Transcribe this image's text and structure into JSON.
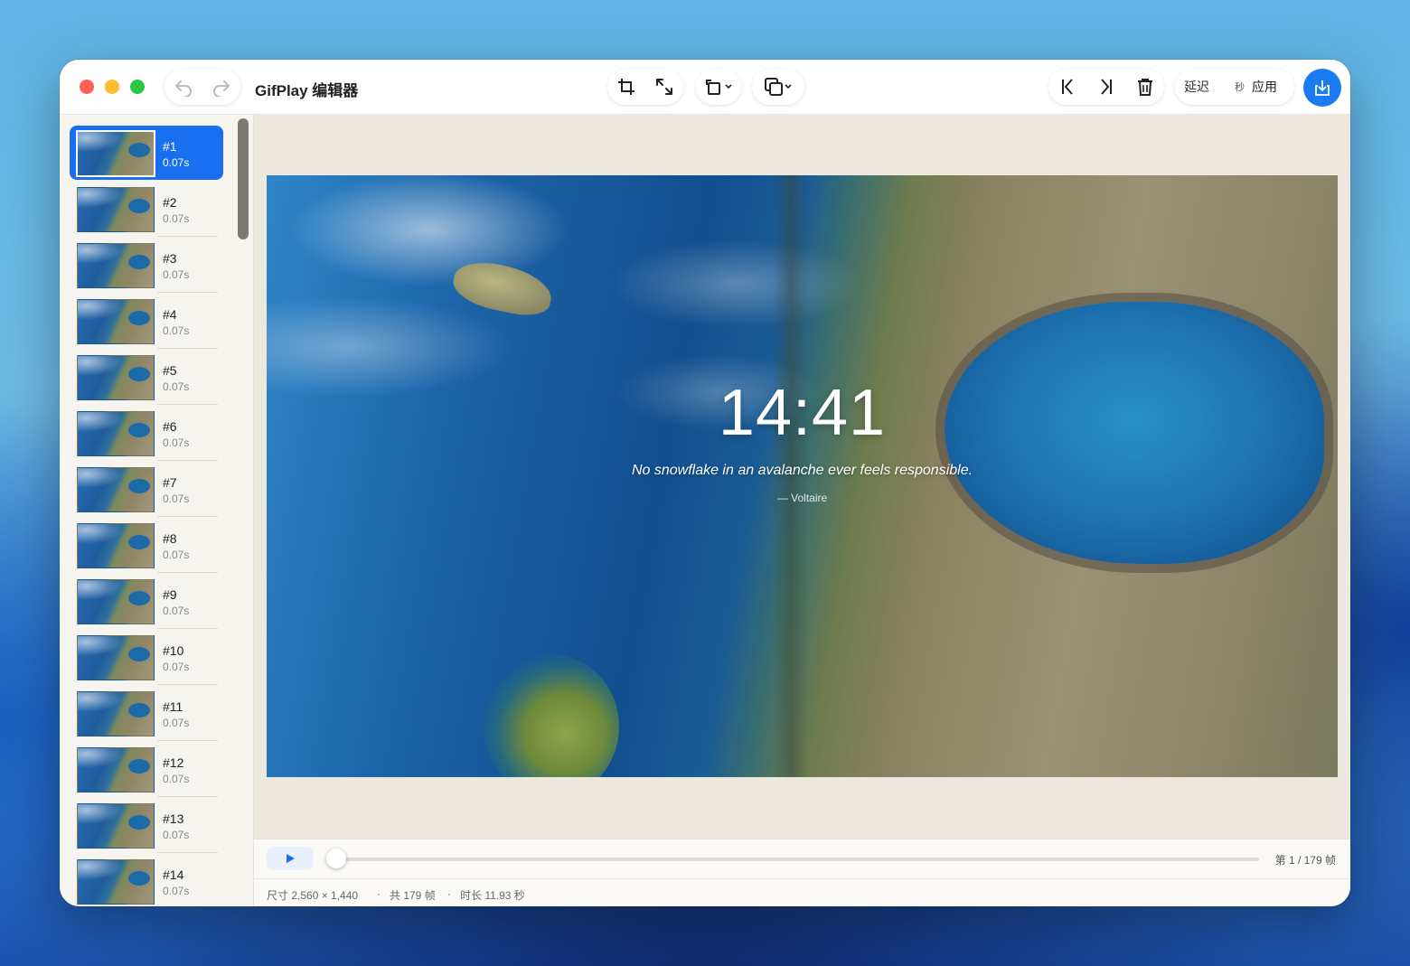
{
  "window": {
    "title": "GifPlay 编辑器"
  },
  "toolbar": {
    "undo_icon": "undo-icon",
    "redo_icon": "redo-icon",
    "crop_icon": "crop-icon",
    "resize_icon": "resize-icon",
    "rotate_icon": "rotate-icon",
    "duplicate_icon": "duplicate-icon",
    "first_frame_icon": "skip-to-start-icon",
    "last_frame_icon": "skip-to-end-icon",
    "delete_icon": "trash-icon",
    "delay_label": "延迟",
    "delay_unit": "秒",
    "apply_label": "应用",
    "export_icon": "export-icon"
  },
  "frames": [
    {
      "num": "#1",
      "dur": "0.07s",
      "selected": true
    },
    {
      "num": "#2",
      "dur": "0.07s"
    },
    {
      "num": "#3",
      "dur": "0.07s"
    },
    {
      "num": "#4",
      "dur": "0.07s"
    },
    {
      "num": "#5",
      "dur": "0.07s"
    },
    {
      "num": "#6",
      "dur": "0.07s"
    },
    {
      "num": "#7",
      "dur": "0.07s"
    },
    {
      "num": "#8",
      "dur": "0.07s"
    },
    {
      "num": "#9",
      "dur": "0.07s"
    },
    {
      "num": "#10",
      "dur": "0.07s"
    },
    {
      "num": "#11",
      "dur": "0.07s"
    },
    {
      "num": "#12",
      "dur": "0.07s"
    },
    {
      "num": "#13",
      "dur": "0.07s"
    },
    {
      "num": "#14",
      "dur": "0.07s"
    }
  ],
  "preview": {
    "time": "14:41",
    "quote": "No snowflake in an avalanche ever feels responsible.",
    "author": "— Voltaire"
  },
  "playback": {
    "play_icon": "play-icon",
    "progress": 0,
    "counter": "第 1 / 179 帧"
  },
  "status": {
    "size": "尺寸 2,560 × 1,440",
    "frames": "共 179 帧",
    "duration": "时长 11.93 秒",
    "separator": "·"
  },
  "colors": {
    "accent": "#1a6ff0",
    "close": "#fe5f57",
    "minimize": "#febc2e",
    "zoom": "#28c840"
  }
}
